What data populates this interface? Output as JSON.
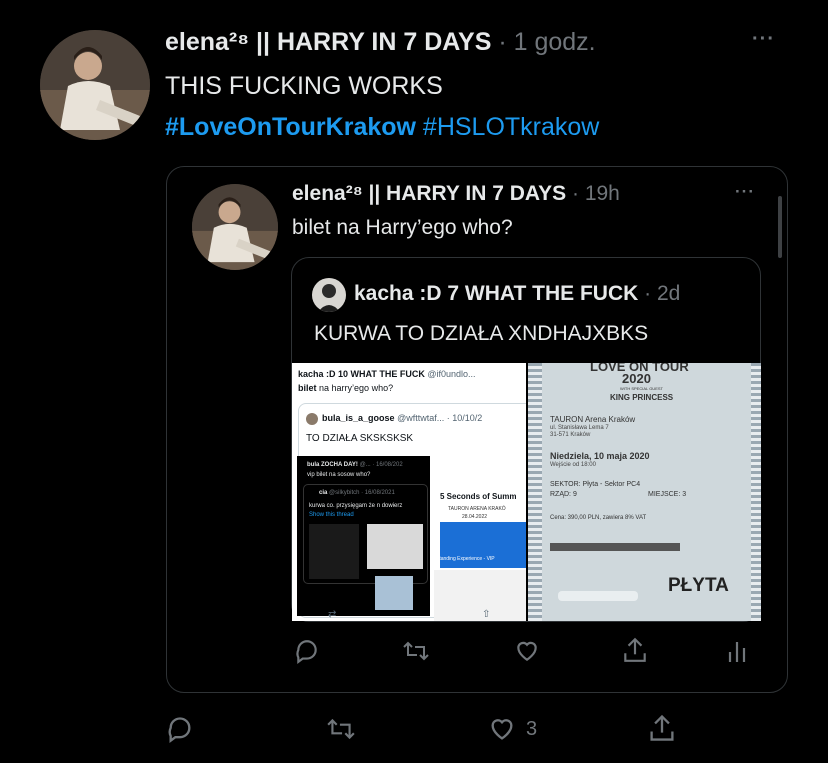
{
  "tweet": {
    "author": "elena²⁸ || HARRY IN 7 DAYS",
    "time": "· 1 godz.",
    "text": "THIS FUCKING WORKS",
    "hashtag1": "#LoveOnTourKrakow",
    "hashtag2": "#HSLOTkrakow",
    "more": "···",
    "like_count": "3"
  },
  "quote": {
    "author": "elena²⁸ || HARRY IN 7 DAYS",
    "time": "· 19h",
    "text": "bilet na Harry’ego who?",
    "more": "···"
  },
  "inner": {
    "author": "kacha :D 7 WHAT THE FUCK",
    "time": "· 2d",
    "text": "KURWA TO DZIAŁA XNDHAJXBKS"
  },
  "screenshot": {
    "l1_author": "kacha :D 10 WHAT THE FUCK",
    "l1_handle": "@if0undlo...",
    "l1_text_bold": "bilet",
    "l1_text": "na harry’ego who?",
    "l2_author": "bula_is_a_goose",
    "l2_handle": "@wfttwtaf... · 10/10/2",
    "l2_text": "TO DZIAŁA SKSKSKSK",
    "l3_author": "bula ZOCHA DAY!",
    "l3_date": "@... · 16/08/202",
    "l3_text": "vip bilet na sosow who?",
    "l4_author": "cia",
    "l4_handle": "@silkybitch · 16/08/2021",
    "l4_text": "kurwa co. przysięgam że n dowierz",
    "l4_link": "Show this thread",
    "card_title": "5 Seconds of Summ",
    "card_venue": "TAURON ARENA KRAKÓ",
    "card_date": "28.04.2022",
    "card_tag": "Standing Experience - VIP",
    "ticket_title": "LOVE ON TOUR",
    "ticket_year": "2020",
    "ticket_special": "WITH SPECIAL GUEST",
    "ticket_guest": "KING PRINCESS",
    "ticket_venue": "TAURON Arena Kraków",
    "ticket_addr1": "ul. Stanisława Lema 7",
    "ticket_addr2": "31-571 Kraków",
    "ticket_date": "Niedziela, 10 maja 2020",
    "ticket_entry": "Wejście od 18:00",
    "ticket_sector": "SEKTOR: Płyta - Sektor PC4",
    "ticket_row": "RZĄD: 9",
    "ticket_seat": "MIEJSCE: 3",
    "ticket_price": "Cena: 390,00 PLN, zawiera 8% VAT",
    "ticket_zone": "PŁYTA"
  }
}
